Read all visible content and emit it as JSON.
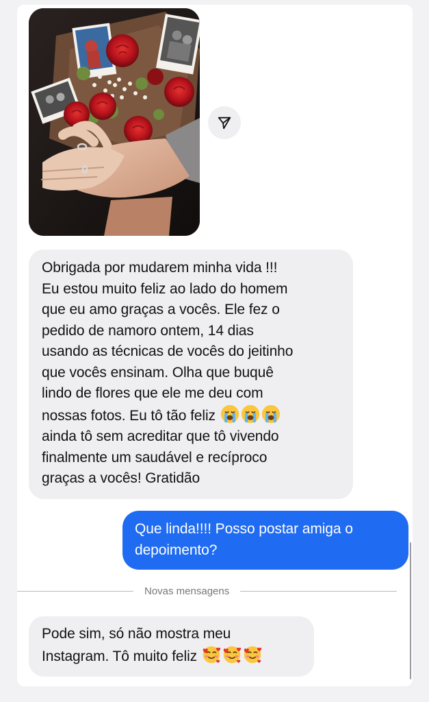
{
  "messages": {
    "photo": {
      "alt": "Photo of a bouquet of red roses with printed photos and two hands with rings"
    },
    "incoming_1": {
      "text": "Obrigada por mudarem minha vida !!!\nEu estou muito feliz ao lado do homem\nque eu amo graças a vocês. Ele fez o\npedido de namoro ontem, 14 dias\nusando as técnicas de vocês do jeitinho\nque vocês ensinam. Olha que buquê\nlindo de flores que ele me deu com\nnossas fotos. Eu tô tão feliz ",
      "text_after": "\nainda tô sem acreditar que tô vivendo\nfinalmente um saudável e recíproco\ngraças a vocês! Gratidão",
      "emojis": [
        "loudly-crying-face-icon",
        "loudly-crying-face-icon",
        "loudly-crying-face-icon"
      ]
    },
    "outgoing_1": {
      "text": "Que linda!!!! Posso postar amiga o\ndepoimento?"
    },
    "divider": {
      "label": "Novas mensagens"
    },
    "incoming_2": {
      "text": "Pode sim, só não mostra meu\nInstagram. Tô muito feliz ",
      "emojis": [
        "smiling-face-with-hearts-icon",
        "smiling-face-with-hearts-icon",
        "smiling-face-with-hearts-icon"
      ]
    }
  },
  "colors": {
    "page_background": "#f2f2f4",
    "incoming_bubble": "#efeff1",
    "outgoing_bubble": "#1f6bf1",
    "divider_text": "#77777d"
  },
  "icons": {
    "share": "share-paper-plane-icon"
  }
}
